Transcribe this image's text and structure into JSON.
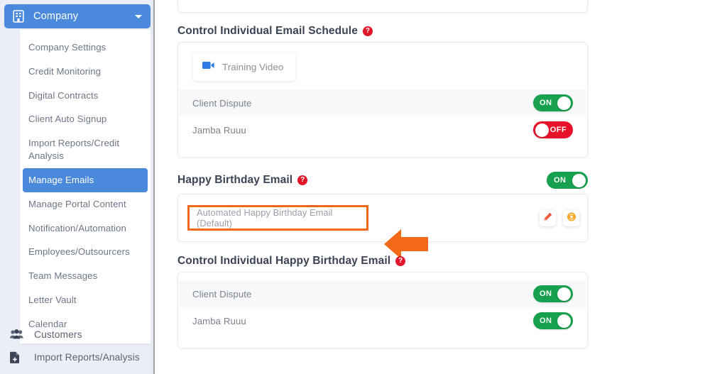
{
  "sidebar": {
    "company_button": {
      "label": "Company",
      "icon": "building-icon",
      "caret": "chevron-down-icon"
    },
    "dropdown_items": [
      {
        "label": "Company Settings",
        "active": false
      },
      {
        "label": "Credit Monitoring",
        "active": false
      },
      {
        "label": "Digital Contracts",
        "active": false
      },
      {
        "label": "Client Auto Signup",
        "active": false
      },
      {
        "label": "Import Reports/Credit Analysis",
        "active": false
      },
      {
        "label": "Manage Emails",
        "active": true
      },
      {
        "label": "Manage Portal Content",
        "active": false
      },
      {
        "label": "Notification/Automation",
        "active": false
      },
      {
        "label": "Employees/Outsourcers",
        "active": false
      },
      {
        "label": "Team Messages",
        "active": false
      },
      {
        "label": "Letter Vault",
        "active": false
      },
      {
        "label": "Calendar",
        "active": false
      }
    ],
    "bottom_nav": [
      {
        "label": "Customers",
        "icon": "users-icon"
      },
      {
        "label": "Import Reports/Analysis",
        "icon": "file-plus-icon"
      }
    ]
  },
  "main": {
    "top_card": {
      "green_button_label": ""
    },
    "email_schedule": {
      "title": "Control Individual Email Schedule",
      "help_icon": "help-circle-icon",
      "training_video_label": "Training Video",
      "training_video_icon": "video-camera-icon",
      "rows": [
        {
          "label": "Client Dispute",
          "toggle_state": "ON"
        },
        {
          "label": "Jamba Ruuu",
          "toggle_state": "OFF"
        }
      ]
    },
    "happy_birthday": {
      "title": "Happy Birthday Email",
      "help_icon": "help-circle-icon",
      "header_toggle_state": "ON",
      "template_name": "Automated Happy Birthday Email (Default)",
      "edit_icon": "pencil-icon",
      "preview_icon": "eye-icon"
    },
    "individual_birthday": {
      "title": "Control Individual Happy Birthday Email",
      "help_icon": "help-circle-icon",
      "rows": [
        {
          "label": "Client Dispute",
          "toggle_state": "ON"
        },
        {
          "label": "Jamba Ruuu",
          "toggle_state": "ON"
        }
      ]
    },
    "annotation": {
      "shape": "left-arrow-annotation",
      "color": "#f26a17"
    }
  },
  "colors": {
    "brand_blue": "#4a89dc",
    "toggle_on_green": "#17a14e",
    "toggle_off_red": "#e8132b",
    "annotation_orange": "#f26a17",
    "help_red": "#e0162b",
    "sidebar_bg": "#eaeff7"
  }
}
